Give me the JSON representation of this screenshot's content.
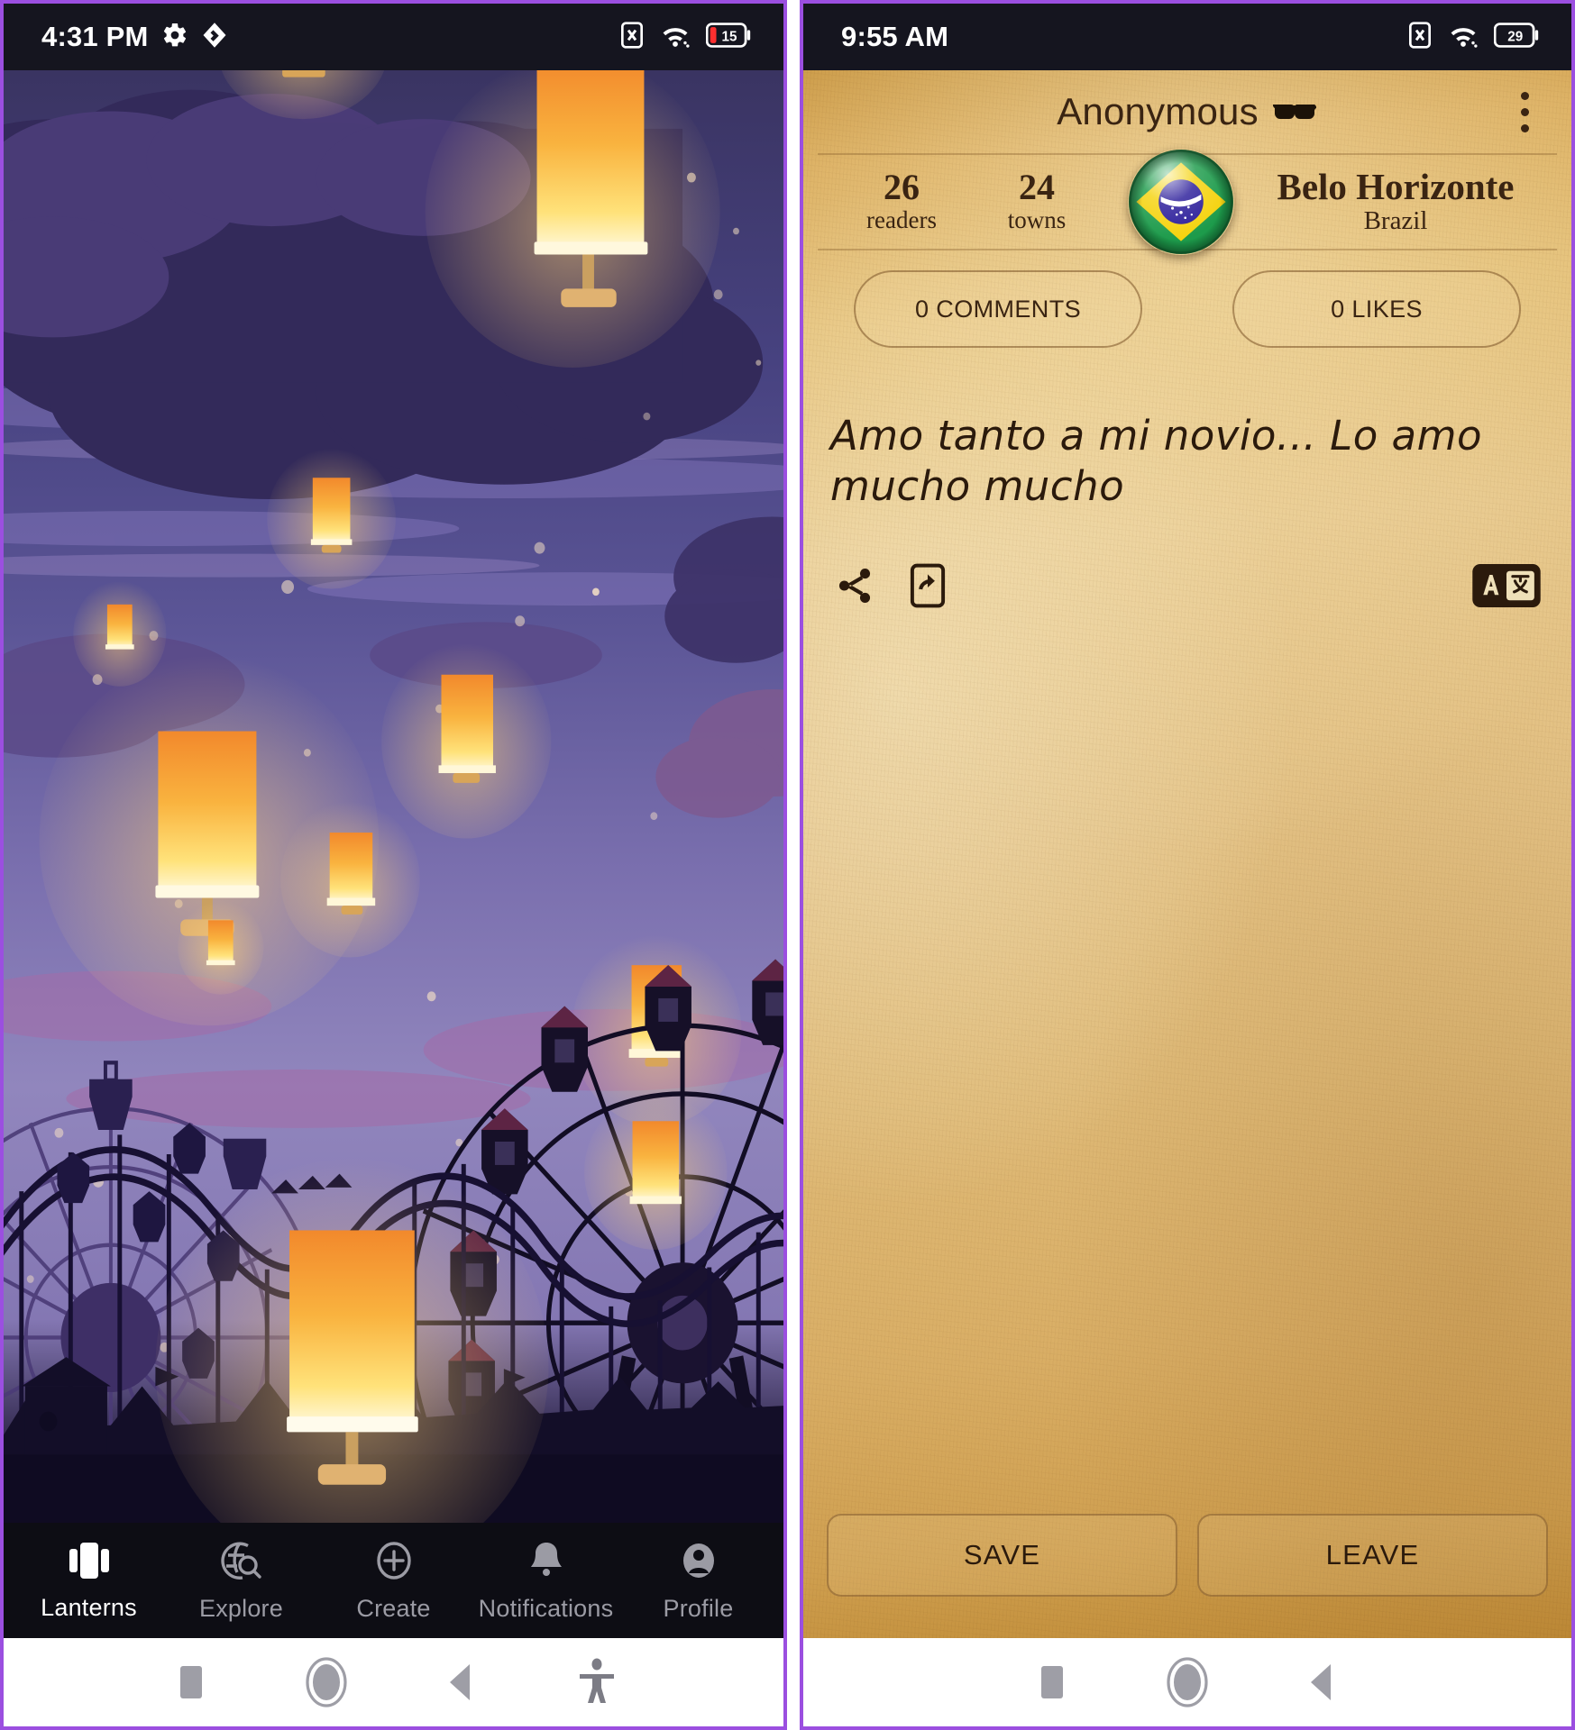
{
  "left_phone": {
    "status_bar": {
      "time": "4:31 PM",
      "icons_left": [
        "gear-icon",
        "app-glyph-icon"
      ],
      "icons_right": [
        "no-sim-icon",
        "wifi-icon",
        "battery-icon"
      ],
      "battery_percent": "15"
    },
    "scene": {
      "name": "night-sky-lanterns-ferris-wheel",
      "sky_top_color": "#37305c",
      "sky_mid_color": "#8b80b8",
      "ground_color": "#181430",
      "lantern_color": "#f7a53c"
    },
    "bottom_nav": {
      "items": [
        {
          "label": "Lanterns",
          "icon": "lanterns-icon",
          "active": true
        },
        {
          "label": "Explore",
          "icon": "explore-search-globe-icon",
          "active": false
        },
        {
          "label": "Create",
          "icon": "plus-circle-icon",
          "active": false
        },
        {
          "label": "Notifications",
          "icon": "bell-icon",
          "active": false
        },
        {
          "label": "Profile",
          "icon": "person-circle-icon",
          "active": false
        }
      ]
    },
    "system_nav": {
      "buttons": [
        "recents-square-icon",
        "home-circle-icon",
        "back-triangle-icon",
        "accessibility-icon"
      ]
    }
  },
  "right_phone": {
    "status_bar": {
      "time": "9:55 AM",
      "icons_right": [
        "no-sim-icon",
        "wifi-icon",
        "battery-icon"
      ],
      "battery_percent": "29"
    },
    "header": {
      "title": "Anonymous",
      "title_emoji": "sunglasses-emoji",
      "overflow_menu": "kebab-menu-icon"
    },
    "stats": {
      "readers_count": "26",
      "readers_label": "readers",
      "towns_count": "24",
      "towns_label": "towns",
      "flag": "brazil-flag-icon",
      "city": "Belo Horizonte",
      "country": "Brazil"
    },
    "chips": {
      "comments": "0 COMMENTS",
      "likes": "0 LIKES"
    },
    "message": {
      "text": "Amo tanto a mi novio... Lo amo mucho mucho"
    },
    "actions": [
      {
        "name": "share-icon"
      },
      {
        "name": "send-to-phone-icon"
      },
      {
        "name": "translate-icon"
      }
    ],
    "buttons": {
      "save": "SAVE",
      "leave": "LEAVE"
    },
    "system_nav": {
      "buttons": [
        "recents-square-icon",
        "home-circle-icon",
        "back-triangle-icon"
      ]
    },
    "colors": {
      "paper_light": "#e6c587",
      "paper_dark": "#bf8b36",
      "ink": "#3a2412",
      "frame_purple": "#9b4fe0"
    }
  }
}
